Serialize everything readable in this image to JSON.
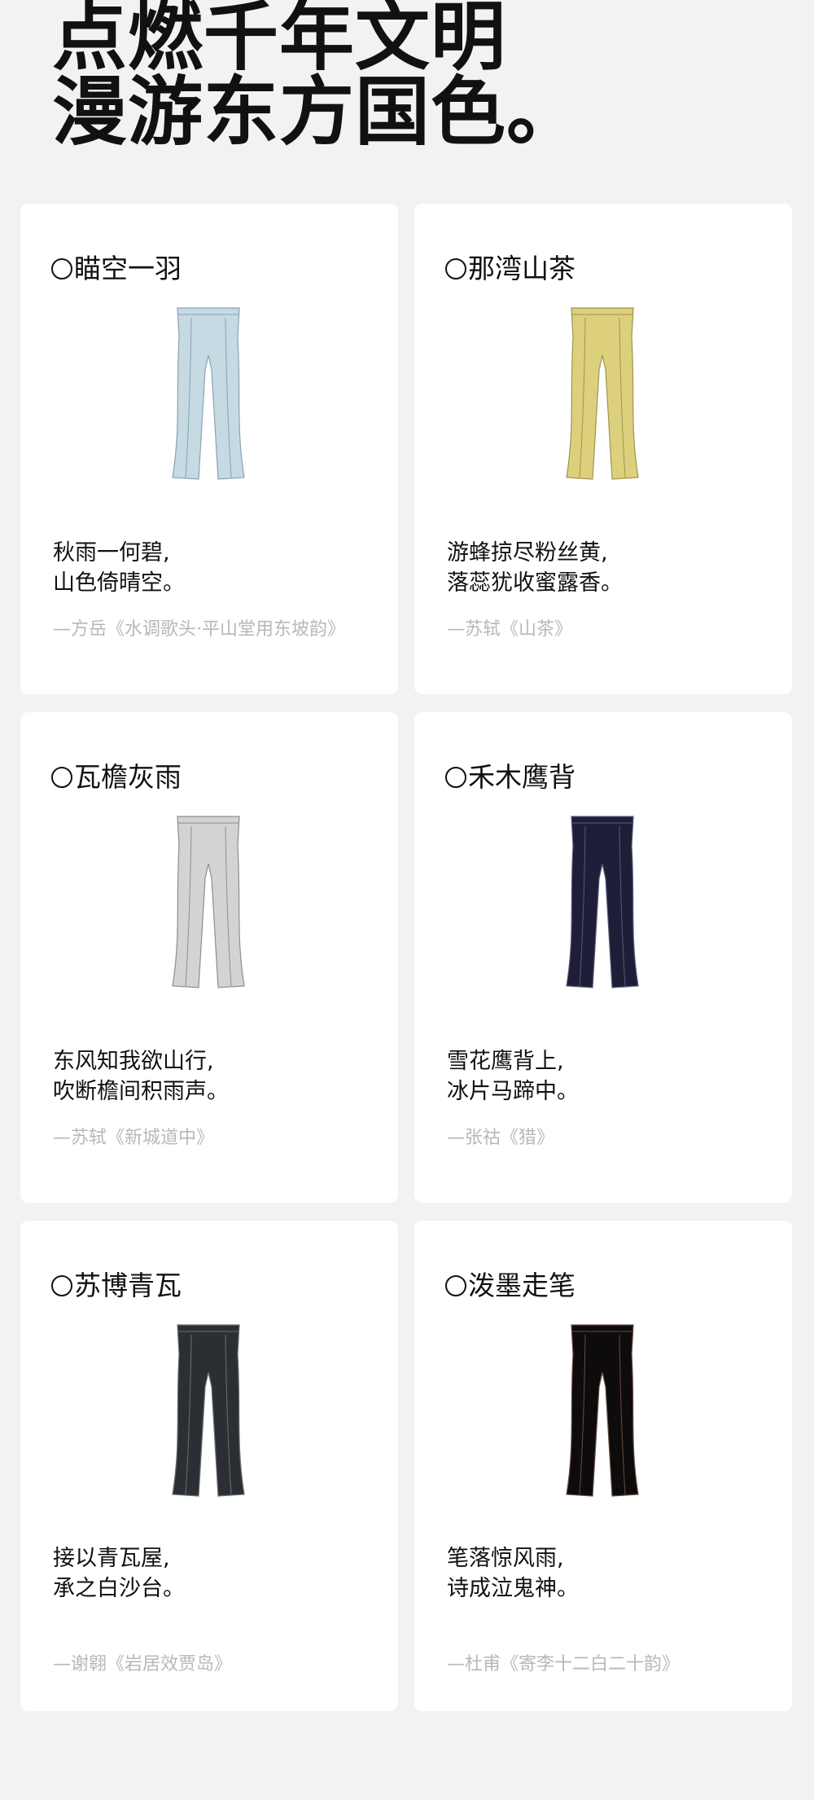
{
  "headline": {
    "line1": "点燃千年文明",
    "line2": "漫游东方国色。"
  },
  "cards": [
    {
      "title": "瞄空一羽",
      "color": "#c5dae3",
      "stroke": "#8aa3b0",
      "poem_line1": "秋雨一何碧,",
      "poem_line2": "山色倚晴空。",
      "source": "—方岳《水调歌头·平山堂用东坡韵》"
    },
    {
      "title": "那湾山茶",
      "color": "#dcd07c",
      "stroke": "#9e9450",
      "poem_line1": "游蜂掠尽粉丝黄,",
      "poem_line2": "落蕊犹收蜜露香。",
      "source": "—苏轼《山茶》"
    },
    {
      "title": "瓦檐灰雨",
      "color": "#d3d3d1",
      "stroke": "#8e8e8c",
      "poem_line1": "东风知我欲山行,",
      "poem_line2": "吹断檐间积雨声。",
      "source": "—苏轼《新城道中》"
    },
    {
      "title": "禾木鹰背",
      "color": "#1e1e38",
      "stroke": "#5a5a78",
      "poem_line1": "雪花鹰背上,",
      "poem_line2": "冰片马蹄中。",
      "source": "—张祜《猎》"
    },
    {
      "title": "苏博青瓦",
      "color": "#2b2f33",
      "stroke": "#6a7075",
      "poem_line1": "接以青瓦屋,",
      "poem_line2": "承之白沙台。",
      "source": "—谢翱《岩居效贾岛》"
    },
    {
      "title": "泼墨走笔",
      "color": "#0d0b0b",
      "stroke": "#6a4c40",
      "poem_line1": "笔落惊风雨,",
      "poem_line2": "诗成泣鬼神。",
      "source": "—杜甫《寄李十二白二十韵》"
    }
  ]
}
